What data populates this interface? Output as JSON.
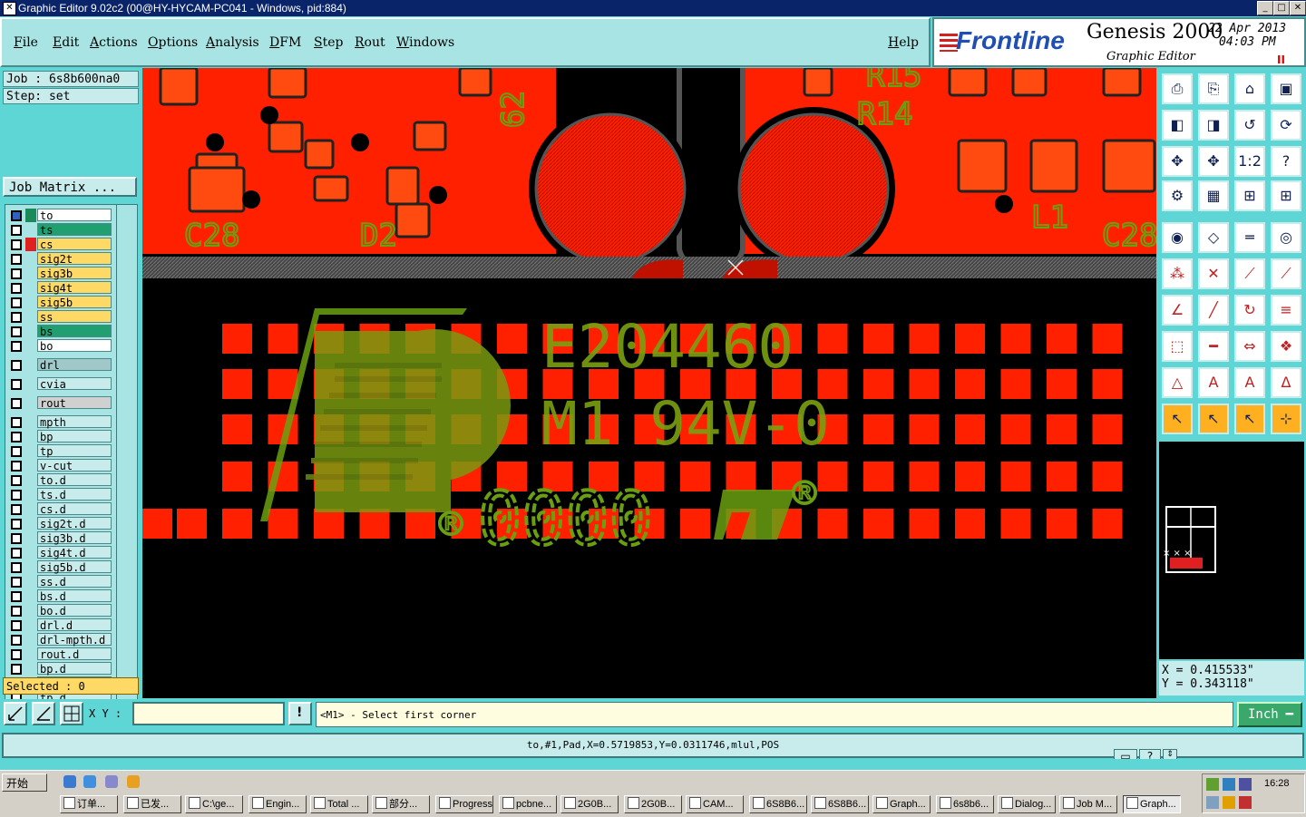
{
  "window": {
    "title": "Graphic Editor 9.02c2 (00@HY-HYCAM-PC041 - Windows, pid:884)",
    "controls": {
      "minimize": "_",
      "maximize": "□",
      "close": "✕"
    }
  },
  "menu": [
    "File",
    "Edit",
    "Actions",
    "Options",
    "Analysis",
    "DFM",
    "Step",
    "Rout",
    "Windows"
  ],
  "help_label": "Help",
  "logo": {
    "brand": "Frontline",
    "product": "Genesis 2000",
    "subtitle": "Graphic Editor",
    "date": "22 Apr 2013",
    "time": "04:03 PM",
    "pause": "II"
  },
  "job": {
    "job_line": "Job : 6s8b600na0",
    "step_line": "Step: set",
    "matrix_button": "Job Matrix ..."
  },
  "layers": [
    {
      "name": "to",
      "color": "#1a8a5a",
      "bg": "#ffffff",
      "active": true
    },
    {
      "name": "ts",
      "color": "",
      "bg": "#20a070"
    },
    {
      "name": "cs",
      "color": "#e02020",
      "bg": "#ffd966"
    },
    {
      "name": "sig2t",
      "color": "",
      "bg": "#ffd966"
    },
    {
      "name": "sig3b",
      "color": "",
      "bg": "#ffd966"
    },
    {
      "name": "sig4t",
      "color": "",
      "bg": "#ffd966"
    },
    {
      "name": "sig5b",
      "color": "",
      "bg": "#ffd966"
    },
    {
      "name": "ss",
      "color": "",
      "bg": "#ffd966"
    },
    {
      "name": "bs",
      "color": "",
      "bg": "#20a070"
    },
    {
      "name": "bo",
      "color": "",
      "bg": "#ffffff"
    },
    {
      "name": "drl",
      "color": "",
      "bg": "#a0c8c8"
    },
    {
      "name": "cvia",
      "color": "",
      "bg": "#c8ecec"
    },
    {
      "name": "rout",
      "color": "",
      "bg": "#d0d0d0"
    },
    {
      "name": "mpth",
      "color": "",
      "bg": "#c8ecec"
    },
    {
      "name": "bp",
      "color": "",
      "bg": "#c8ecec"
    },
    {
      "name": "tp",
      "color": "",
      "bg": "#c8ecec"
    },
    {
      "name": "v-cut",
      "color": "",
      "bg": "#c8ecec"
    },
    {
      "name": "to.d",
      "color": "",
      "bg": "#c8ecec"
    },
    {
      "name": "ts.d",
      "color": "",
      "bg": "#c8ecec"
    },
    {
      "name": "cs.d",
      "color": "",
      "bg": "#c8ecec"
    },
    {
      "name": "sig2t.d",
      "color": "",
      "bg": "#c8ecec"
    },
    {
      "name": "sig3b.d",
      "color": "",
      "bg": "#c8ecec"
    },
    {
      "name": "sig4t.d",
      "color": "",
      "bg": "#c8ecec"
    },
    {
      "name": "sig5b.d",
      "color": "",
      "bg": "#c8ecec"
    },
    {
      "name": "ss.d",
      "color": "",
      "bg": "#c8ecec"
    },
    {
      "name": "bs.d",
      "color": "",
      "bg": "#c8ecec"
    },
    {
      "name": "bo.d",
      "color": "",
      "bg": "#c8ecec"
    },
    {
      "name": "drl.d",
      "color": "",
      "bg": "#c8ecec"
    },
    {
      "name": "drl-mpth.d",
      "color": "",
      "bg": "#c8ecec"
    },
    {
      "name": "rout.d",
      "color": "",
      "bg": "#c8ecec"
    },
    {
      "name": "bp.d",
      "color": "",
      "bg": "#c8ecec"
    },
    {
      "name": "dd.d",
      "color": "",
      "bg": "#c8ecec"
    },
    {
      "name": "tp.d",
      "color": "",
      "bg": "#c8ecec"
    }
  ],
  "selected_text": "Selected : 0",
  "canvas": {
    "silkscreen_top": [
      "C28",
      "D2",
      "R14",
      "R15",
      "L1",
      "C28",
      "62"
    ],
    "marking_line1": "E204460",
    "marking_line2": "M1 94V-0",
    "marking_code": "0000",
    "reg_mark": "®"
  },
  "coords": {
    "x": "X = 0.415533\"",
    "y": "Y = 0.343118\""
  },
  "command": {
    "xy_label": "X Y :",
    "xy_value": "",
    "alert_icon": "!",
    "prompt": "<M1> - Select first corner",
    "unit": "Inch"
  },
  "status_line": "to,#1,Pad,X=0.5719853,Y=0.0311746,mlul,POS",
  "taskbar": {
    "start": "开始",
    "tasks": [
      "订单...",
      "已发...",
      "C:\\ge...",
      "Engin...",
      "Total ...",
      "部分...",
      "Progress",
      "pcbne...",
      "2G0B...",
      "2G0B...",
      "CAM...",
      "6S8B6...",
      "6S8B6...",
      "Graph...",
      "6s8b6...",
      "Dialog...",
      "Job M...",
      "Graph..."
    ],
    "active_task": 17,
    "clock": "16:28"
  },
  "colors": {
    "teal": "#5fd6d6",
    "copper_red": "#ff2000",
    "silk_green": "#5a9a10",
    "bg_black": "#000000"
  }
}
